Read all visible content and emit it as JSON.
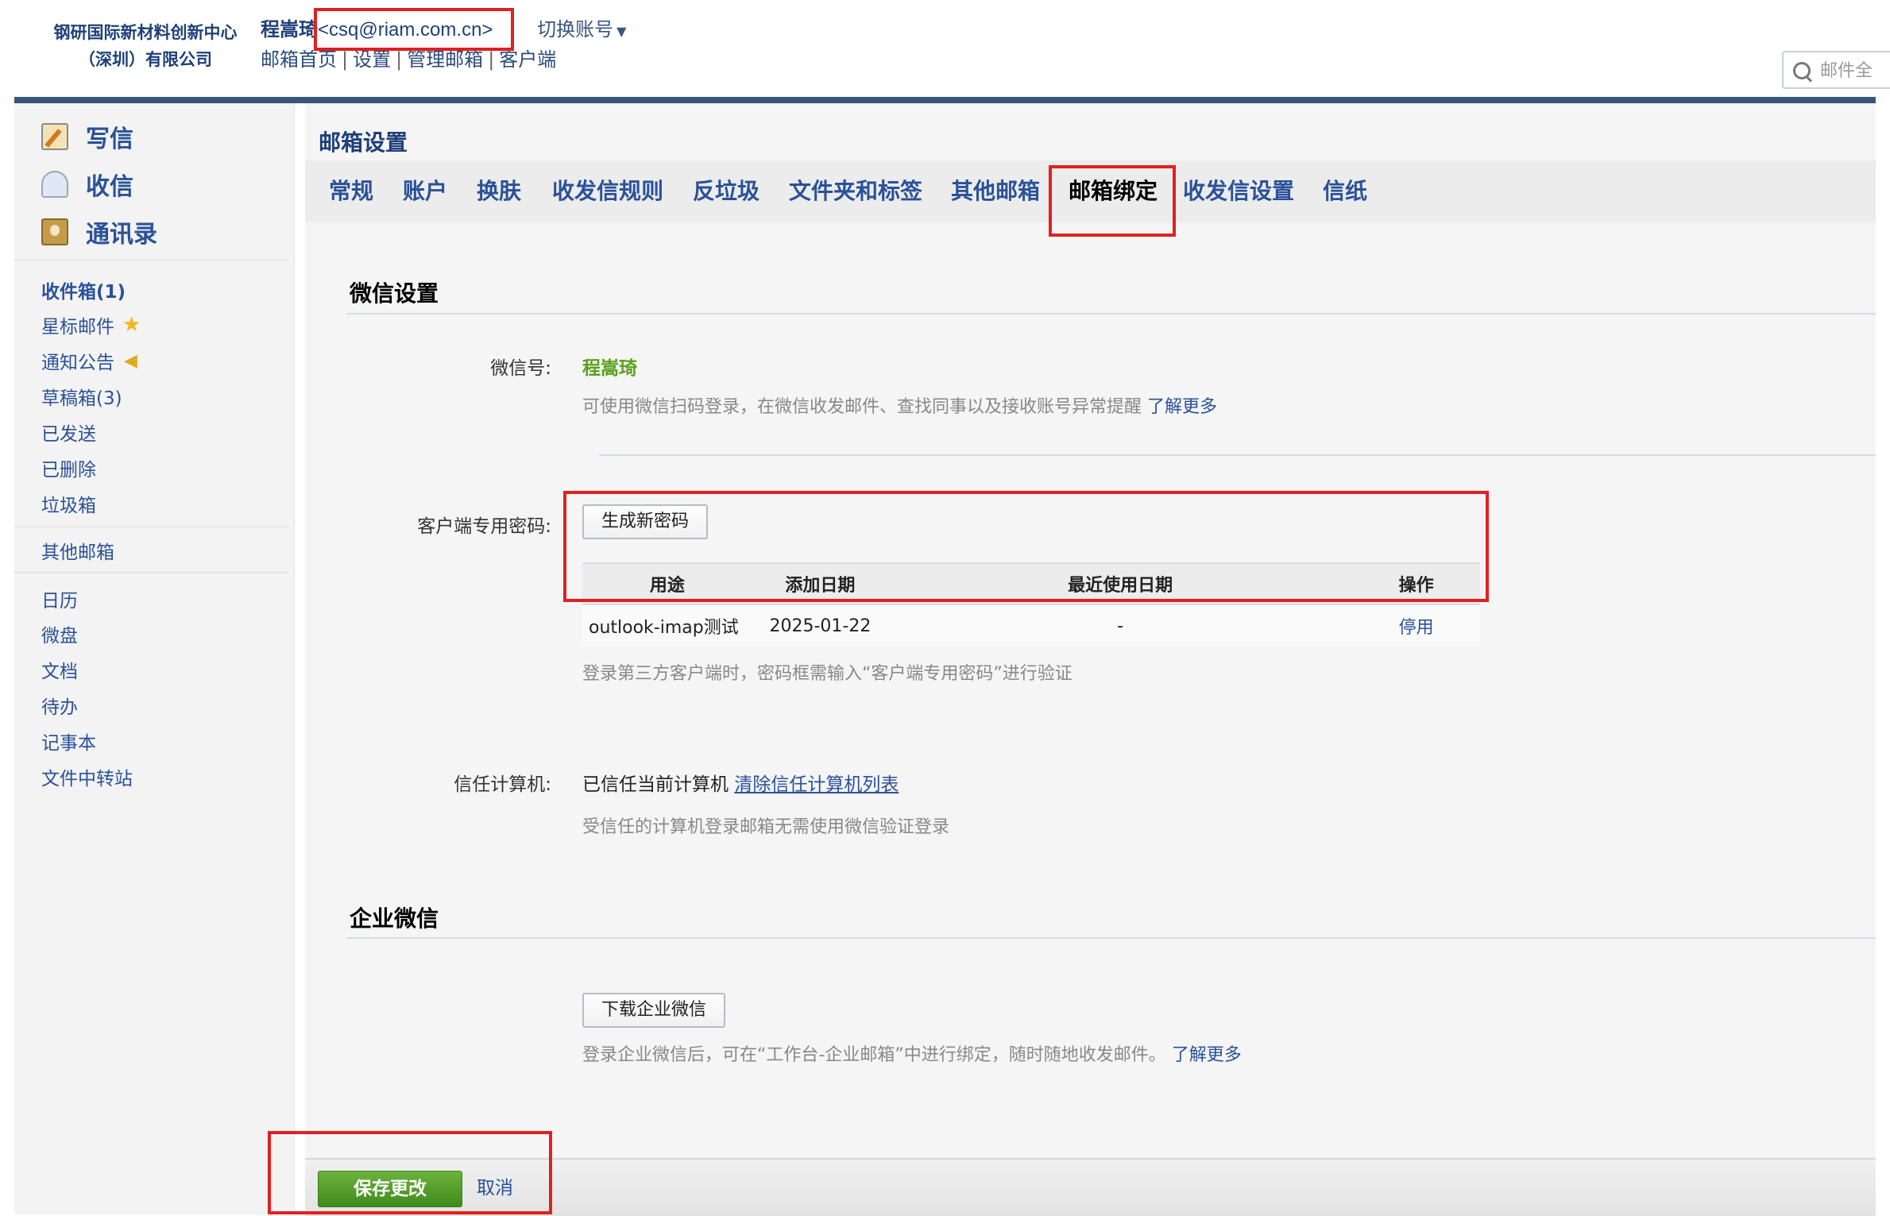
{
  "header": {
    "org_name_line1": "钢研国际新材料创新中心",
    "org_name_line2": "（深圳）有限公司",
    "user_name": "程嵩琦",
    "user_email": "<csq@riam.com.cn>",
    "switch_account": "切换账号",
    "links": [
      "邮箱首页",
      "设置",
      "管理邮箱",
      "客户端"
    ],
    "search_placeholder": "邮件全"
  },
  "sidebar": {
    "actions": [
      {
        "label": "写信",
        "icon": "compose-icon"
      },
      {
        "label": "收信",
        "icon": "inbox-icon"
      },
      {
        "label": "通讯录",
        "icon": "contacts-icon"
      }
    ],
    "folders": [
      "收件箱(1)",
      "星标邮件",
      "通知公告",
      "草稿箱(3)",
      "已发送",
      "已删除",
      "垃圾箱"
    ],
    "other_mailbox": "其他邮箱",
    "apps": [
      "日历",
      "微盘",
      "文档",
      "待办",
      "记事本",
      "文件中转站"
    ]
  },
  "main": {
    "page_title": "邮箱设置",
    "tabs": [
      "常规",
      "账户",
      "换肤",
      "收发信规则",
      "反垃圾",
      "文件夹和标签",
      "其他邮箱",
      "邮箱绑定",
      "收发信设置",
      "信纸"
    ],
    "active_tab": "邮箱绑定",
    "wechat_section": {
      "title": "微信设置",
      "wechat_label": "微信号:",
      "wechat_value": "程嵩琦",
      "wechat_hint": "可使用微信扫码登录，在微信收发邮件、查找同事以及接收账号异常提醒",
      "learn_more": "了解更多",
      "client_pw_label": "客户端专用密码:",
      "generate_button": "生成新密码",
      "table": {
        "headers": [
          "用途",
          "添加日期",
          "最近使用日期",
          "操作"
        ],
        "rows": [
          [
            "outlook-imap测试",
            "2025-01-22",
            "-",
            "停用"
          ]
        ]
      },
      "client_pw_hint": "登录第三方客户端时，密码框需输入“客户端专用密码”进行验证",
      "trust_label": "信任计算机:",
      "trust_text": "已信任当前计算机",
      "trust_link": "清除信任计算机列表",
      "trust_hint": "受信任的计算机登录邮箱无需使用微信验证登录"
    },
    "wework_section": {
      "title": "企业微信",
      "download_button": "下载企业微信",
      "hint": "登录企业微信后，可在“工作台-企业邮箱”中进行绑定，随时随地收发邮件。",
      "learn_more": "了解更多"
    },
    "footer": {
      "save_button": "保存更改",
      "cancel_link": "取消"
    }
  },
  "colors": {
    "accent_blue": "#2a5199",
    "header_bar": "#3a5578",
    "highlight_red": "#e02020",
    "wechat_green": "#5aa01e",
    "save_green": "#4e9a28"
  }
}
